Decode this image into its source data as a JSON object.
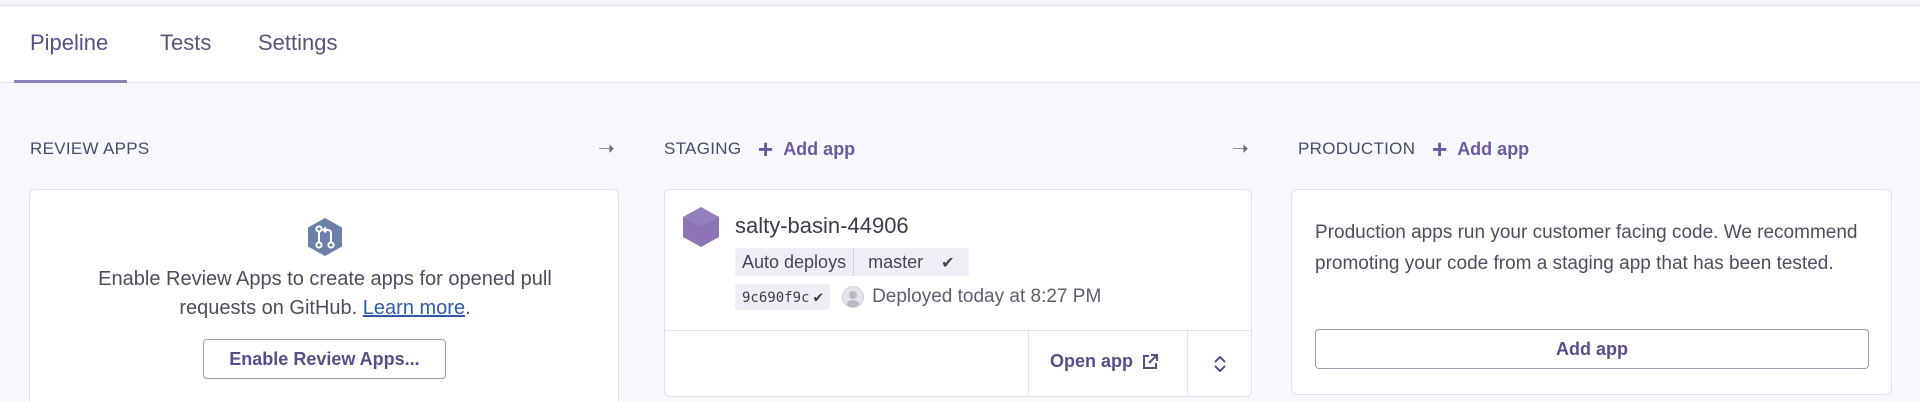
{
  "tabs": [
    {
      "label": "Pipeline",
      "active": true
    },
    {
      "label": "Tests",
      "active": false
    },
    {
      "label": "Settings",
      "active": false
    }
  ],
  "columns": {
    "review": {
      "title": "REVIEW APPS",
      "icon": "git-pull-request-icon",
      "description_prefix": "Enable Review Apps to create apps for opened pull requests on GitHub.",
      "learn_more": "Learn more",
      "description_suffix": ".",
      "button_label": "Enable Review Apps..."
    },
    "staging": {
      "title": "STAGING",
      "add_app_label": "Add app",
      "app": {
        "name": "salty-basin-44906",
        "auto_deploys_label": "Auto deploys",
        "branch": "master",
        "commit": "9c690f9c",
        "deployed_text": "Deployed today at 8:27 PM",
        "open_app_label": "Open app"
      }
    },
    "production": {
      "title": "PRODUCTION",
      "add_app_label": "Add app",
      "description": "Production apps run your customer facing code. We recommend promoting your code from a staging app that has been tested.",
      "button_label": "Add app"
    }
  },
  "colors": {
    "accent": "#5a4d8a",
    "app_icon": "#8c74b6",
    "link": "#2f5aa8"
  }
}
